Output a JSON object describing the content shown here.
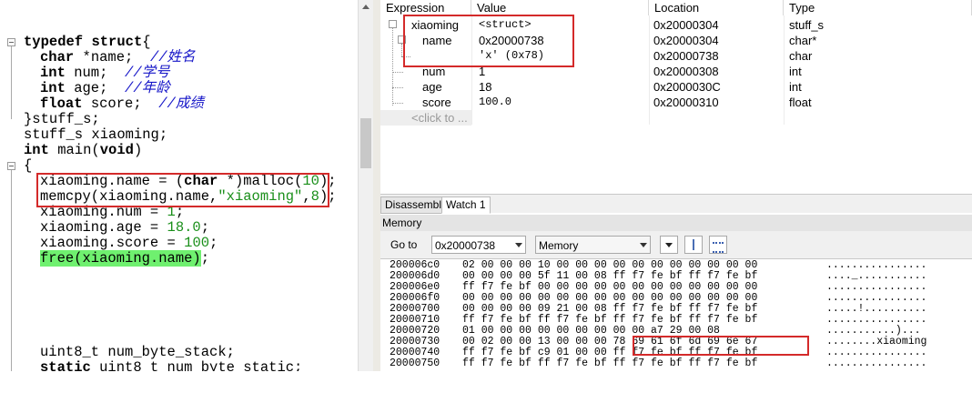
{
  "editor": {
    "lines": {
      "typedef": {
        "kw1": "typedef",
        "kw2": "struct",
        "rest": "{"
      },
      "field_name": {
        "type": "char",
        "decl": " *name;  ",
        "comment": "//姓名"
      },
      "field_num": {
        "type": "int",
        "decl": " num;  ",
        "comment": "//学号"
      },
      "field_age": {
        "type": "int",
        "decl": " age;  ",
        "comment": "//年龄"
      },
      "field_score": {
        "type": "float",
        "decl": " score;  ",
        "comment": "//成绩"
      },
      "close_struct": "}stuff_s;",
      "var_decl": "stuff_s xiaoming;",
      "main_decl": {
        "type": "int",
        "name": " main(",
        "void": "void",
        "close": ")"
      },
      "open_brace": "{",
      "malloc": {
        "a": "xiaoming.name = (",
        "kw": "char",
        "b": " *)malloc(",
        "n": "10",
        "c": ");"
      },
      "memcpy": {
        "a": "memcpy(xiaoming.name,",
        "s": "\"xiaoming\"",
        "b": ",",
        "n": "8",
        "c": ");"
      },
      "num_assign": {
        "a": "xiaoming.num = ",
        "n": "1",
        "b": ";"
      },
      "age_assign": {
        "a": "xiaoming.age = ",
        "n": "18.0",
        "b": ";"
      },
      "score_assign": {
        "a": "xiaoming.score = ",
        "n": "100",
        "b": ";"
      },
      "free_call": {
        "hl": "free(xiaoming.name)",
        "rest": ";"
      },
      "u8_stack": "uint8_t num_byte_stack;",
      "u8_static": {
        "kw": "static",
        "rest": " uint8_t num_byte_static;"
      }
    }
  },
  "watch": {
    "headers": [
      "Expression",
      "Value",
      "Location",
      "Type"
    ],
    "rows": [
      {
        "expr": "xiaoming",
        "value": "<struct>",
        "loc": "0x20000304",
        "type": "stuff_s"
      },
      {
        "expr": "name",
        "value": "0x20000738",
        "loc": "0x20000304",
        "type": "char*"
      },
      {
        "expr": "",
        "value": "'x' (0x78)",
        "loc": "0x20000738",
        "type": "char"
      },
      {
        "expr": "num",
        "value": "1",
        "loc": "0x20000308",
        "type": "int"
      },
      {
        "expr": "age",
        "value": "18",
        "loc": "0x2000030C",
        "type": "int"
      },
      {
        "expr": "score",
        "value": "100.0",
        "loc": "0x20000310",
        "type": "float"
      }
    ],
    "add_placeholder": "<click to ..."
  },
  "tabs": [
    "Disassembly",
    "Watch 1"
  ],
  "memory": {
    "title": "Memory",
    "goto_label": "Go to",
    "address": "0x20000738",
    "view_mode": "Memory",
    "rows": [
      {
        "addr": "200006c0",
        "bytes": "02 00 00 00 10 00 00 00 00 00 00 00 00 00 00 00",
        "ascii": "................"
      },
      {
        "addr": "200006d0",
        "bytes": "00 00 00 00 5f 11 00 08 ff f7 fe bf ff f7 fe bf",
        "ascii": "...._..........."
      },
      {
        "addr": "200006e0",
        "bytes": "ff f7 fe bf 00 00 00 00 00 00 00 00 00 00 00 00",
        "ascii": "................"
      },
      {
        "addr": "200006f0",
        "bytes": "00 00 00 00 00 00 00 00 00 00 00 00 00 00 00 00",
        "ascii": "................"
      },
      {
        "addr": "20000700",
        "bytes": "00 00 00 00 09 21 00 08 ff f7 fe bf ff f7 fe bf",
        "ascii": ".....!.........."
      },
      {
        "addr": "20000710",
        "bytes": "ff f7 fe bf ff f7 fe bf ff f7 fe bf ff f7 fe bf",
        "ascii": "................"
      },
      {
        "addr": "20000720",
        "bytes": "01 00 00 00 00 00 00 00 00 00 a7 29 00 08",
        "ascii": "...........)..."
      },
      {
        "addr": "20000730",
        "bytes": "00 02 00 00 13 00 00 00 78 69 61 6f 6d 69 6e 67",
        "ascii": "........xiaoming"
      },
      {
        "addr": "20000740",
        "bytes": "ff f7 fe bf c9 01 00 00 ff f7 fe bf ff f7 fe bf",
        "ascii": "................"
      },
      {
        "addr": "20000750",
        "bytes": "ff f7 fe bf ff f7 fe bf ff f7 fe bf ff f7 fe bf",
        "ascii": "................"
      }
    ]
  },
  "colors": {
    "highlight_box": "#d42a2a",
    "executed_line": "#6ff06f",
    "comment": "#1515c8",
    "literal": "#1a8f1a"
  }
}
